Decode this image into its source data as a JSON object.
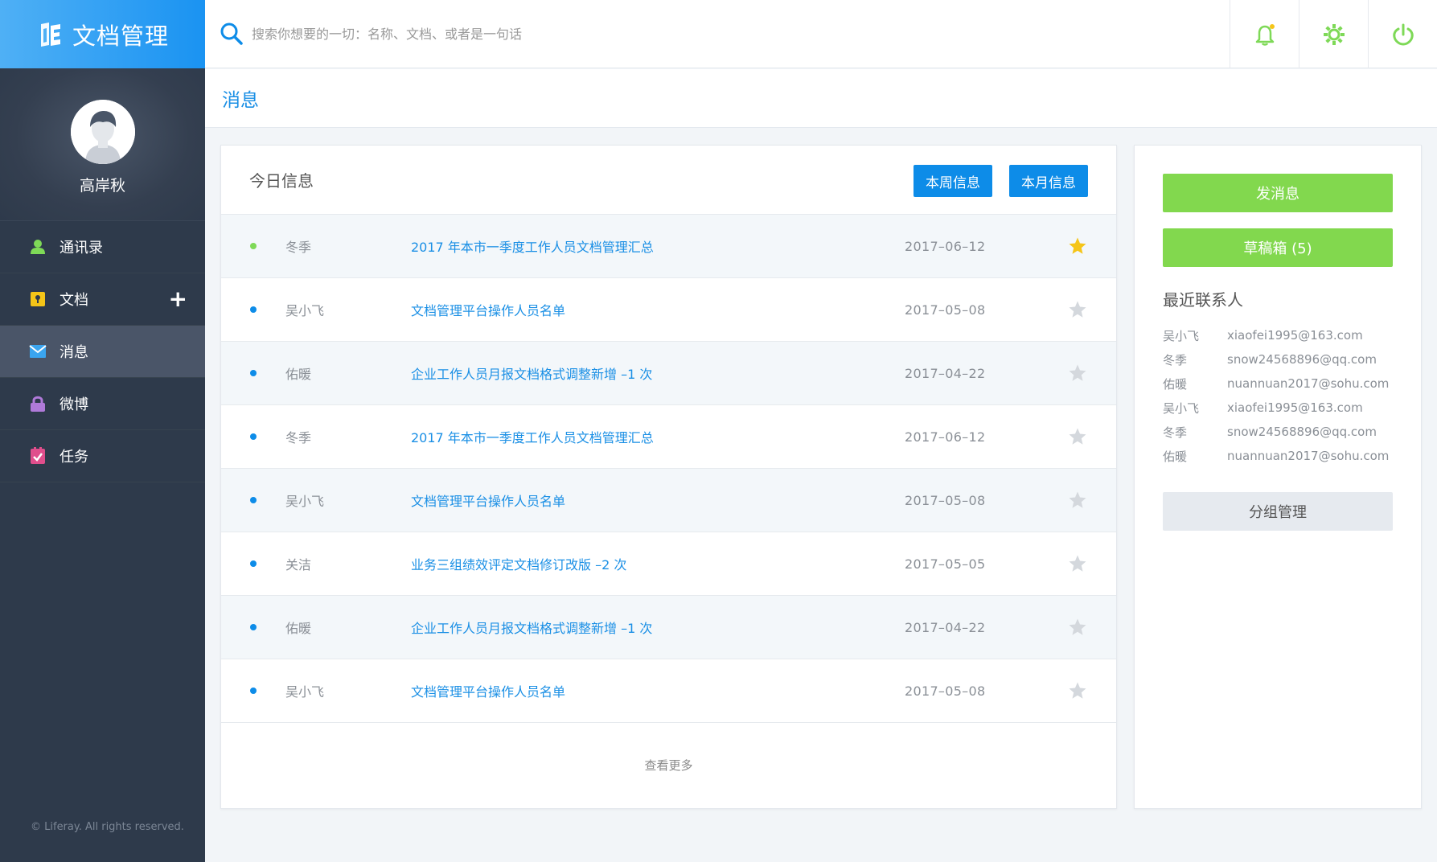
{
  "app": {
    "title": "文档管理",
    "logo_icon": "document-logo-icon"
  },
  "search": {
    "placeholder": "搜索你想要的一切：名称、文档、或者是一句话",
    "icon": "search-icon"
  },
  "top_actions": [
    {
      "name": "notification-bell",
      "icon": "bell-icon",
      "color": "#7ed957",
      "badge_color": "#f5c518"
    },
    {
      "name": "settings",
      "icon": "gear-icon",
      "color": "#7ed957"
    },
    {
      "name": "logout",
      "icon": "power-icon",
      "color": "#7ed957"
    }
  ],
  "sidebar": {
    "user": {
      "name": "高岸秋",
      "avatar_icon": "avatar-icon"
    },
    "items": [
      {
        "label": "通讯录",
        "icon": "contacts-icon",
        "color": "#7ed957",
        "active": false
      },
      {
        "label": "文档",
        "icon": "document-icon",
        "color": "#f5c518",
        "active": false,
        "action": "+"
      },
      {
        "label": "消息",
        "icon": "mail-icon",
        "color": "#3aa5f0",
        "active": true
      },
      {
        "label": "微博",
        "icon": "lock-icon",
        "color": "#b07ad9",
        "active": false
      },
      {
        "label": "任务",
        "icon": "task-icon",
        "color": "#e04e8c",
        "active": false
      }
    ],
    "copyright": "© Liferay. All rights reserved."
  },
  "page": {
    "title": "消息"
  },
  "messages": {
    "title": "今日信息",
    "buttons": {
      "week": "本周信息",
      "month": "本月信息"
    },
    "rows": [
      {
        "sender": "冬季",
        "subject": "2017 年本市一季度工作人员文档管理汇总",
        "date": "2017–06–12",
        "starred": true,
        "unread_color": "green"
      },
      {
        "sender": "吴小飞",
        "subject": "文档管理平台操作人员名单",
        "date": "2017–05–08",
        "starred": false,
        "unread_color": "blue"
      },
      {
        "sender": "佑暖",
        "subject": "企业工作人员月报文档格式调整新增 –1 次",
        "date": "2017–04–22",
        "starred": false,
        "unread_color": "blue"
      },
      {
        "sender": "冬季",
        "subject": "2017 年本市一季度工作人员文档管理汇总",
        "date": "2017–06–12",
        "starred": false,
        "unread_color": "blue"
      },
      {
        "sender": "吴小飞",
        "subject": "文档管理平台操作人员名单",
        "date": "2017–05–08",
        "starred": false,
        "unread_color": "blue"
      },
      {
        "sender": "关洁",
        "subject": "业务三组绩效评定文档修订改版 –2 次",
        "date": "2017–05–05",
        "starred": false,
        "unread_color": "blue"
      },
      {
        "sender": "佑暖",
        "subject": "企业工作人员月报文档格式调整新增 –1 次",
        "date": "2017–04–22",
        "starred": false,
        "unread_color": "blue"
      },
      {
        "sender": "吴小飞",
        "subject": "文档管理平台操作人员名单",
        "date": "2017–05–08",
        "starred": false,
        "unread_color": "blue"
      }
    ],
    "see_more": "查看更多"
  },
  "side": {
    "send_button": "发消息",
    "drafts_button": "草稿箱 (5)",
    "contacts_title": "最近联系人",
    "contacts": [
      {
        "name": "吴小飞",
        "email": "xiaofei1995@163.com"
      },
      {
        "name": "冬季",
        "email": "snow24568896@qq.com"
      },
      {
        "name": "佑暖",
        "email": "nuannuan2017@sohu.com"
      },
      {
        "name": "吴小飞",
        "email": "xiaofei1995@163.com"
      },
      {
        "name": "冬季",
        "email": "snow24568896@qq.com"
      },
      {
        "name": "佑暖",
        "email": "nuannuan2017@sohu.com"
      }
    ],
    "group_button": "分组管理"
  },
  "colors": {
    "accent": "#0d8ce8",
    "green": "#82d84e",
    "sidebar": "#2e3a4b",
    "star_active": "#f5c518",
    "star_inactive": "#d4d8dd"
  }
}
